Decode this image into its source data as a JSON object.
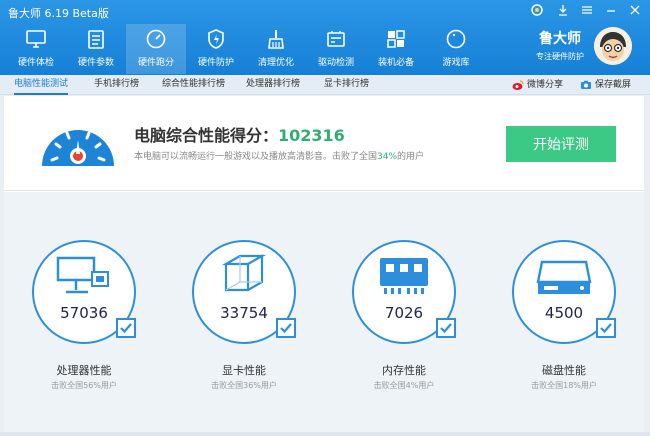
{
  "window": {
    "title": "鲁大师 6.19 Beta版"
  },
  "nav": [
    {
      "label": "硬件体检",
      "icon": "monitor-icon"
    },
    {
      "label": "硬件参数",
      "icon": "clipboard-icon"
    },
    {
      "label": "硬件跑分",
      "icon": "speedometer-icon"
    },
    {
      "label": "硬件防护",
      "icon": "shield-icon"
    },
    {
      "label": "清理优化",
      "icon": "broom-icon"
    },
    {
      "label": "驱动检测",
      "icon": "driver-icon"
    },
    {
      "label": "装机必备",
      "icon": "apps-grid-icon"
    },
    {
      "label": "游戏库",
      "icon": "gamepad-icon"
    }
  ],
  "brand": {
    "name": "鲁大师",
    "subtitle": "专注硬件防护"
  },
  "subtabs": [
    "电脑性能测试",
    "手机排行榜",
    "综合性能排行榜",
    "处理器排行榜",
    "显卡排行榜"
  ],
  "share": {
    "weibo": "微博分享",
    "screenshot": "保存截屏"
  },
  "score": {
    "label": "电脑综合性能得分：",
    "value": "102316",
    "desc_prefix": "本电脑可以流畅运行一般游戏以及播放高清影音。击败了全国",
    "desc_pct": "34%",
    "desc_suffix": "的用户"
  },
  "start_button": "开始评测",
  "cards": [
    {
      "value": "57036",
      "title": "处理器性能",
      "sub": "击败全国56%用户",
      "icon": "cpu-icon"
    },
    {
      "value": "33754",
      "title": "显卡性能",
      "sub": "击败全国36%用户",
      "icon": "gpu-cube-icon"
    },
    {
      "value": "7026",
      "title": "内存性能",
      "sub": "击败全国4%用户",
      "icon": "memory-icon"
    },
    {
      "value": "4500",
      "title": "磁盘性能",
      "sub": "击败全国18%用户",
      "icon": "disk-icon"
    }
  ],
  "colors": {
    "accent": "#1a7fd2",
    "score_green": "#2faf6f",
    "button_green": "#3cc885",
    "gauge_red": "#e8452c"
  }
}
